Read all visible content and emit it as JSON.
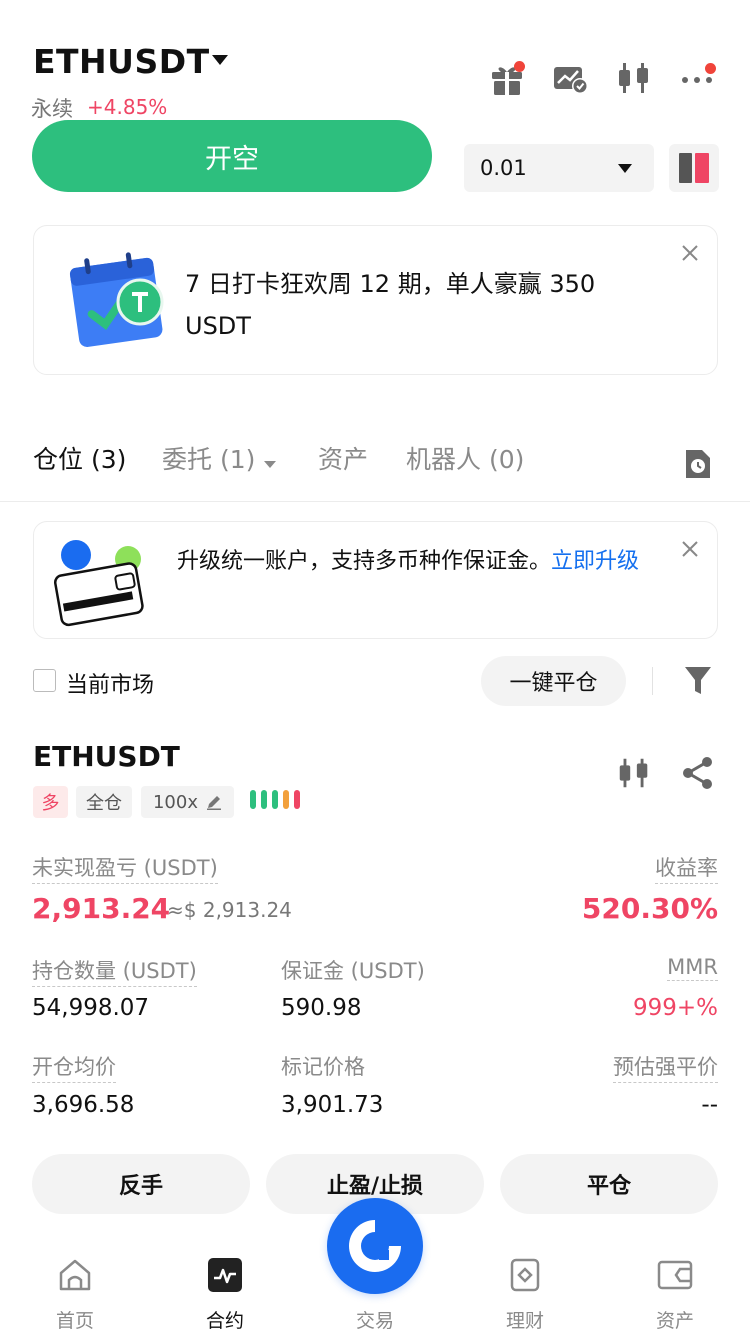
{
  "header": {
    "symbol": "ETHUSDT",
    "contract_type": "永续",
    "change": "+4.85%",
    "icons": [
      "gift-icon",
      "chart-check-icon",
      "candlestick-icon",
      "more-icon"
    ]
  },
  "order": {
    "open_short_label": "开空",
    "quantity": "0.01"
  },
  "promo": {
    "text": "7 日打卡狂欢周 12 期，单人豪赢 350 USDT"
  },
  "tabs": [
    {
      "label": "仓位 (3)"
    },
    {
      "label": "委托 (1)"
    },
    {
      "label": "资产"
    },
    {
      "label": "机器人 (0)"
    }
  ],
  "upgrade": {
    "text": "升级统一账户，支持多币种作保证金。",
    "link": "立即升级"
  },
  "filters": {
    "current_market_label": "当前市场",
    "close_all_label": "一键平仓"
  },
  "position": {
    "symbol": "ETHUSDT",
    "side": "多",
    "margin_mode": "全仓",
    "leverage": "100x",
    "unrealized_pnl_label": "未实现盈亏 (USDT)",
    "unrealized_pnl": "2,913.24",
    "unrealized_pnl_usd": "≈$ 2,913.24",
    "roe_label": "收益率",
    "roe": "520.30%",
    "size_label": "持仓数量 (USDT)",
    "size": "54,998.07",
    "margin_label": "保证金 (USDT)",
    "margin": "590.98",
    "mmr_label": "MMR",
    "mmr": "999+%",
    "entry_label": "开仓均价",
    "entry": "3,696.58",
    "mark_label": "标记价格",
    "mark": "3,901.73",
    "liq_label": "预估强平价",
    "liq": "--",
    "reverse_label": "反手",
    "tpsl_label": "止盈/止损",
    "close_label": "平仓"
  },
  "nav": [
    {
      "label": "首页",
      "icon": "home-icon"
    },
    {
      "label": "合约",
      "icon": "futures-icon"
    },
    {
      "label": "交易",
      "icon": "trade-icon"
    },
    {
      "label": "理财",
      "icon": "earn-icon"
    },
    {
      "label": "资产",
      "icon": "wallet-icon"
    }
  ],
  "colors": {
    "green": "#2dbf7e",
    "red": "#ef4564",
    "blue": "#1a6cf0",
    "link": "#1570ef"
  }
}
